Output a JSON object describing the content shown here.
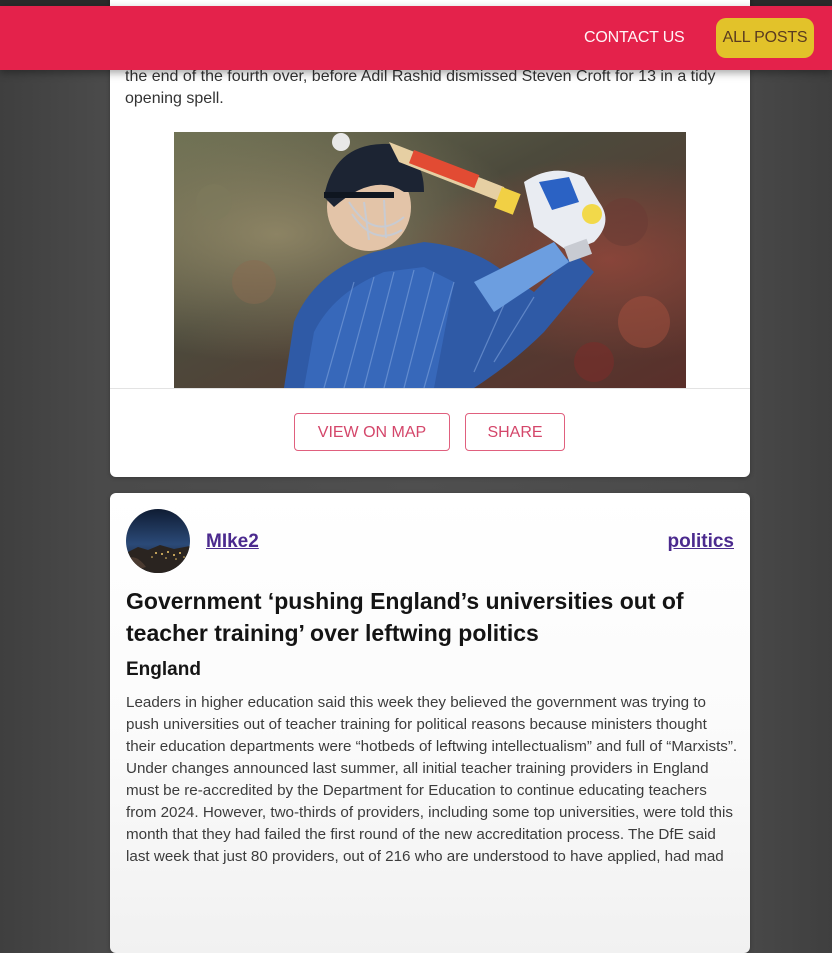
{
  "nav": {
    "contact_label": "CONTACT US",
    "all_posts_label": "ALL POSTS"
  },
  "post_previous": {
    "text_tail": "the end of the fourth over, before Adil Rashid dismissed Steven Croft for 13 in a tidy opening spell.",
    "image_description": "cricket batsman in blue kit swinging bat",
    "view_on_map_label": "VIEW ON MAP",
    "share_label": "SHARE"
  },
  "post": {
    "author": "MIke2",
    "category": "politics",
    "title": "Government ‘pushing England’s universities out of teacher training’ over leftwing politics",
    "location": "England",
    "body": "Leaders in higher education said this week they believed the government was trying to push universities out of teacher training for political reasons because ministers thought their education departments were “hotbeds of leftwing intellectualism” and full of “Marxists”. Under changes announced last summer, all initial teacher training providers in England must be re-accredited by the Department for Education to continue educating teachers from 2024. However, two-thirds of providers, including some top universities, were told this month that they had failed the first round of the new accreditation process. The DfE said last week that just 80 providers, out of 216 who are understood to have applied, had mad"
  },
  "colors": {
    "navbar": "#e4224b",
    "all_posts_button": "#e2c22a",
    "link": "#4b2a8e",
    "outline_button": "#e0607e",
    "page_background": "#4f4f4f"
  }
}
